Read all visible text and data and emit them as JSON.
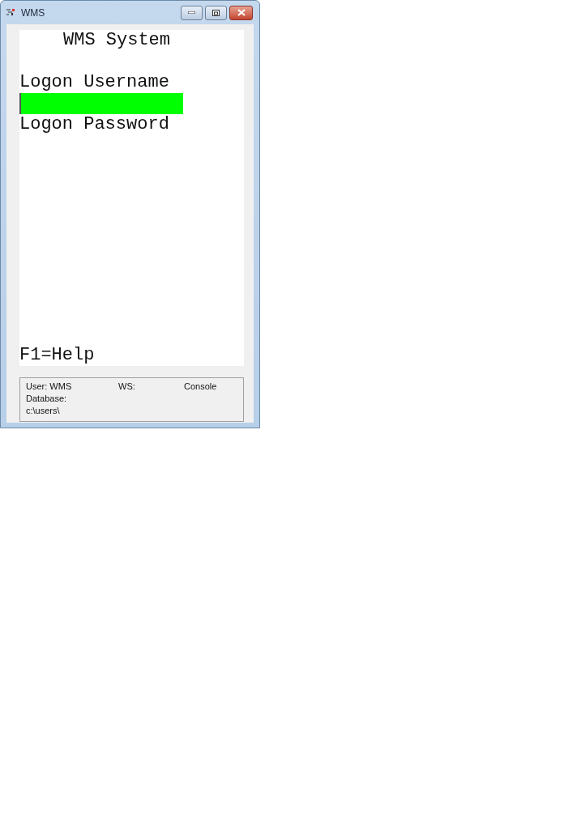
{
  "window": {
    "title": "WMS"
  },
  "screen": {
    "title": "WMS System",
    "lines": [
      {
        "kind": "label",
        "text": "Logon Username"
      },
      {
        "kind": "field"
      },
      {
        "kind": "label",
        "text": "Logon Password"
      }
    ],
    "help": "F1=Help"
  },
  "status_bar": {
    "rows": [
      [
        "User: WMS",
        "WS:",
        "Console"
      ],
      [
        "Database:"
      ],
      [
        "c:\\users\\"
      ]
    ]
  }
}
